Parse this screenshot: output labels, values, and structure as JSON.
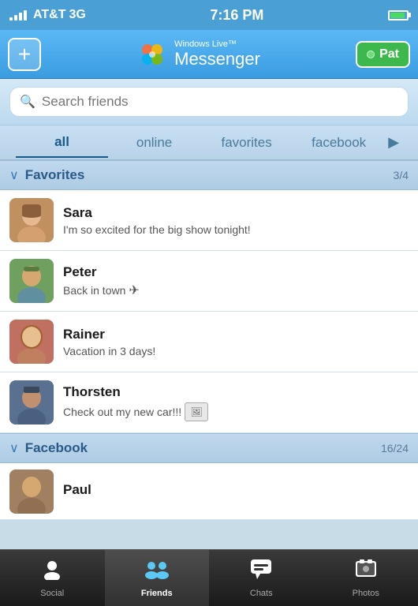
{
  "statusBar": {
    "carrier": "AT&T",
    "network": "3G",
    "time": "7:16 PM"
  },
  "header": {
    "addLabel": "+",
    "logoTopText": "Windows Live™",
    "logoBottomText": "Messenger",
    "profileLabel": "Pat"
  },
  "search": {
    "placeholder": "Search friends"
  },
  "filterTabs": {
    "tabs": [
      {
        "id": "all",
        "label": "all",
        "active": true
      },
      {
        "id": "online",
        "label": "online",
        "active": false
      },
      {
        "id": "favorites",
        "label": "favorites",
        "active": false
      },
      {
        "id": "facebook",
        "label": "facebook",
        "active": false
      }
    ],
    "moreLabel": "▶"
  },
  "sections": [
    {
      "id": "favorites",
      "title": "Favorites",
      "count": "3/4",
      "contacts": [
        {
          "id": "sara",
          "name": "Sara",
          "status": "I'm so excited for the big show tonight!",
          "hasPlane": false,
          "hasPhoto": false
        },
        {
          "id": "peter",
          "name": "Peter",
          "status": "Back in town",
          "hasPlane": true,
          "hasPhoto": false
        },
        {
          "id": "rainer",
          "name": "Rainer",
          "status": "Vacation in 3 days!",
          "hasPlane": false,
          "hasPhoto": false
        },
        {
          "id": "thorsten",
          "name": "Thorsten",
          "status": "Check out my new car!!!",
          "hasPlane": false,
          "hasPhoto": true
        }
      ]
    },
    {
      "id": "facebook",
      "title": "Facebook",
      "count": "16/24",
      "contacts": [
        {
          "id": "paul",
          "name": "Paul",
          "status": "",
          "hasPlane": false,
          "hasPhoto": false
        }
      ]
    }
  ],
  "bottomNav": {
    "items": [
      {
        "id": "social",
        "label": "Social",
        "icon": "👤",
        "active": false
      },
      {
        "id": "friends",
        "label": "Friends",
        "icon": "👥",
        "active": true
      },
      {
        "id": "chats",
        "label": "Chats",
        "icon": "💬",
        "active": false
      },
      {
        "id": "photos",
        "label": "Photos",
        "icon": "🖼",
        "active": false
      }
    ]
  }
}
